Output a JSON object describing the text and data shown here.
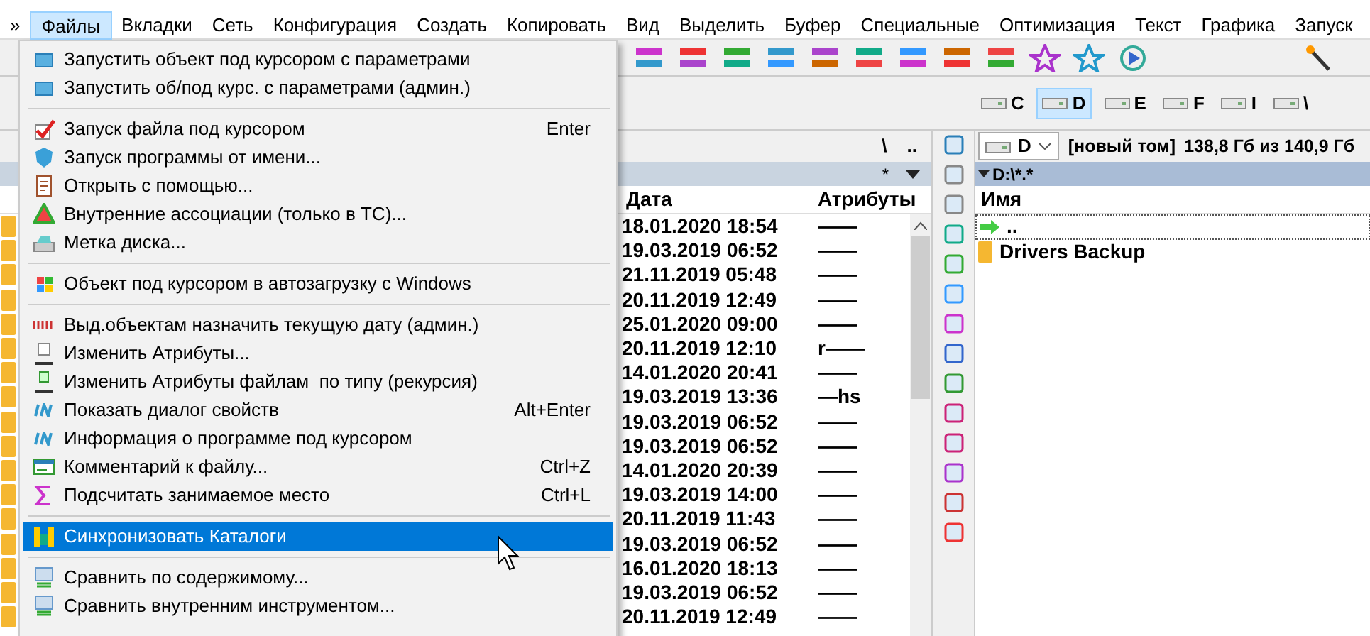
{
  "menubar": [
    {
      "label": "»",
      "selected": false
    },
    {
      "label": "Файлы",
      "selected": true
    },
    {
      "label": "Вкладки",
      "selected": false
    },
    {
      "label": "Сеть",
      "selected": false
    },
    {
      "label": "Конфигурация",
      "selected": false
    },
    {
      "label": "Создать",
      "selected": false
    },
    {
      "label": "Копировать",
      "selected": false
    },
    {
      "label": "Вид",
      "selected": false
    },
    {
      "label": "Выделить",
      "selected": false
    },
    {
      "label": "Буфер",
      "selected": false
    },
    {
      "label": "Специальные",
      "selected": false
    },
    {
      "label": "Оптимизация",
      "selected": false
    },
    {
      "label": "Текст",
      "selected": false
    },
    {
      "label": "Графика",
      "selected": false
    },
    {
      "label": "Запуск",
      "selected": false
    }
  ],
  "drives": [
    {
      "letter": "C",
      "selected": false
    },
    {
      "letter": "D",
      "selected": true
    },
    {
      "letter": "E",
      "selected": false
    },
    {
      "letter": "F",
      "selected": false
    },
    {
      "letter": "I",
      "selected": false
    },
    {
      "letter": "\\",
      "selected": false
    }
  ],
  "left_panel": {
    "nav": [
      "\\",
      ".."
    ],
    "filter": "*",
    "columns": [
      "Дата",
      "Атрибуты"
    ],
    "rows": [
      {
        "date": "18.01.2020 18:54",
        "attributes": "——"
      },
      {
        "date": "19.03.2019 06:52",
        "attributes": "——"
      },
      {
        "date": "21.11.2019 05:48",
        "attributes": "——"
      },
      {
        "date": "20.11.2019 12:49",
        "attributes": "——"
      },
      {
        "date": "25.01.2020 09:00",
        "attributes": "——"
      },
      {
        "date": "20.11.2019 12:10",
        "attributes": "r——"
      },
      {
        "date": "14.01.2020 20:41",
        "attributes": "——"
      },
      {
        "date": "19.03.2019 13:36",
        "attributes": "—hs"
      },
      {
        "date": "19.03.2019 06:52",
        "attributes": "——"
      },
      {
        "date": "19.03.2019 06:52",
        "attributes": "——"
      },
      {
        "date": "14.01.2020 20:39",
        "attributes": "——"
      },
      {
        "date": "19.03.2019 14:00",
        "attributes": "——"
      },
      {
        "date": "20.11.2019 11:43",
        "attributes": "——"
      },
      {
        "date": "19.03.2019 06:52",
        "attributes": "——"
      },
      {
        "date": "16.01.2020 18:13",
        "attributes": "——"
      },
      {
        "date": "19.03.2019 06:52",
        "attributes": "——"
      },
      {
        "date": "20.11.2019 12:49",
        "attributes": "——"
      }
    ]
  },
  "right_panel": {
    "drive": "D",
    "volume": "[новый том]",
    "space": "138,8 Гб из 140,9 Гб",
    "path": "D:\\*.*",
    "columns": [
      "Имя"
    ],
    "rows": [
      {
        "name": "..",
        "kind": "up"
      },
      {
        "name": "Drivers Backup",
        "kind": "folder"
      }
    ]
  },
  "menu": [
    {
      "kind": "item",
      "label": "Запустить объект под курсором с параметрами",
      "selected": false
    },
    {
      "kind": "item",
      "label": "Запустить об/под курс. с параметрами (админ.)",
      "selected": false
    },
    {
      "kind": "separator"
    },
    {
      "kind": "item",
      "label": "Запуск файла под курсором",
      "shortcut": "Enter",
      "selected": false
    },
    {
      "kind": "item",
      "label": "Запуск программы от имени...",
      "selected": false
    },
    {
      "kind": "item",
      "label": "Открыть с помощью...",
      "selected": false
    },
    {
      "kind": "item",
      "label": "Внутренние ассоциации (только в TC)...",
      "selected": false
    },
    {
      "kind": "item",
      "label": "Метка диска...",
      "selected": false
    },
    {
      "kind": "separator"
    },
    {
      "kind": "item",
      "label": "Объект под курсором в автозагрузку с Windows",
      "selected": false
    },
    {
      "kind": "separator"
    },
    {
      "kind": "item",
      "label": "Выд.объектам назначить текущую дату (админ.)",
      "selected": false
    },
    {
      "kind": "item",
      "label": "Изменить Атрибуты...",
      "selected": false
    },
    {
      "kind": "item",
      "label": "Изменить Атрибуты файлам  по типу (рекурсия)",
      "selected": false
    },
    {
      "kind": "item",
      "label": "Показать диалог свойств",
      "shortcut": "Alt+Enter",
      "selected": false
    },
    {
      "kind": "item",
      "label": "Информация о программе под курсором",
      "selected": false
    },
    {
      "kind": "item",
      "label": "Комментарий к файлу...",
      "shortcut": "Ctrl+Z",
      "selected": false
    },
    {
      "kind": "item",
      "label": "Подсчитать занимаемое место",
      "shortcut": "Ctrl+L",
      "selected": false
    },
    {
      "kind": "separator"
    },
    {
      "kind": "item",
      "label": "Синхронизовать Каталоги",
      "selected": true
    },
    {
      "kind": "separator"
    },
    {
      "kind": "item",
      "label": "Сравнить по содержимому...",
      "selected": false
    },
    {
      "kind": "item",
      "label": "Сравнить внутренним инструментом...",
      "selected": false
    }
  ]
}
